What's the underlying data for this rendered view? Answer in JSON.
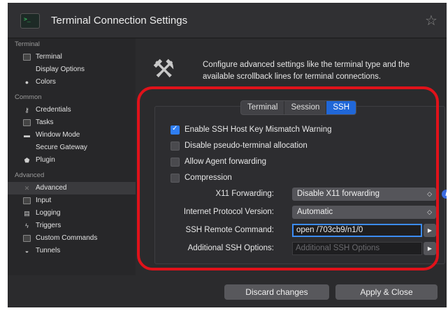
{
  "window": {
    "title": "Terminal Connection Settings",
    "star_icon": "star-icon"
  },
  "sidebar": {
    "sections": [
      {
        "title": "Terminal",
        "items": [
          {
            "label": "Terminal",
            "icon": "terminal-icon"
          },
          {
            "label": "Display Options",
            "icon": ""
          },
          {
            "label": "Colors",
            "icon": "colors-icon"
          }
        ]
      },
      {
        "title": "Common",
        "items": [
          {
            "label": "Credentials",
            "icon": "key-icon"
          },
          {
            "label": "Tasks",
            "icon": "tasks-icon"
          },
          {
            "label": "Window Mode",
            "icon": "window-icon"
          },
          {
            "label": "Secure Gateway",
            "icon": ""
          },
          {
            "label": "Plugin",
            "icon": "plugin-icon"
          }
        ]
      },
      {
        "title": "Advanced",
        "items": [
          {
            "label": "Advanced",
            "icon": "tools-icon",
            "selected": true
          },
          {
            "label": "Input",
            "icon": "keyboard-icon"
          },
          {
            "label": "Logging",
            "icon": "logging-icon"
          },
          {
            "label": "Triggers",
            "icon": "lightning-icon"
          },
          {
            "label": "Custom Commands",
            "icon": "commands-icon"
          },
          {
            "label": "Tunnels",
            "icon": "tunnel-icon"
          }
        ]
      }
    ]
  },
  "main": {
    "description": "Configure advanced settings like the terminal type and the available scrollback lines for terminal connections.",
    "tabs": [
      {
        "label": "Terminal",
        "active": false
      },
      {
        "label": "Session",
        "active": false
      },
      {
        "label": "SSH",
        "active": true
      }
    ],
    "checkboxes": [
      {
        "label": "Enable SSH Host Key Mismatch Warning",
        "checked": true
      },
      {
        "label": "Disable pseudo-terminal allocation",
        "checked": false
      },
      {
        "label": "Allow Agent forwarding",
        "checked": false
      },
      {
        "label": "Compression",
        "checked": false
      }
    ],
    "fields": {
      "x11_label": "X11 Forwarding:",
      "x11_value": "Disable X11 forwarding",
      "ip_label": "Internet Protocol Version:",
      "ip_value": "Automatic",
      "remote_cmd_label": "SSH Remote Command:",
      "remote_cmd_value": "open /703cb9/n1/0",
      "extra_opts_label": "Additional SSH Options:",
      "extra_opts_placeholder": "Additional SSH Options"
    }
  },
  "footer": {
    "discard_label": "Discard changes",
    "apply_label": "Apply & Close"
  },
  "colors": {
    "accent": "#2f7ef3",
    "highlight": "#e0121a",
    "background": "#2b2b2d"
  }
}
